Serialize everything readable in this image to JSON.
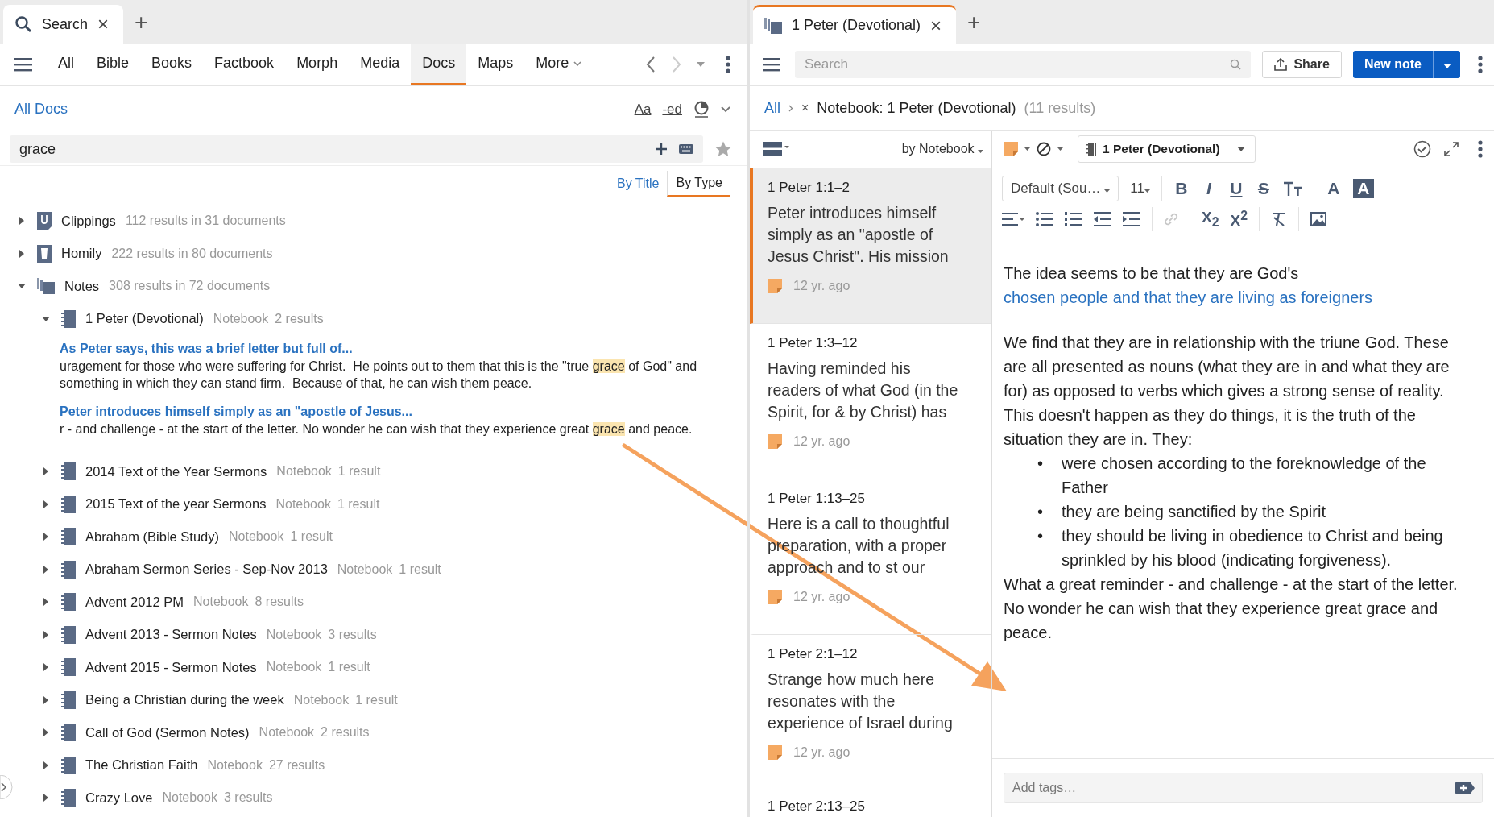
{
  "left_tab": {
    "title": "Search",
    "close": "×",
    "new": "+"
  },
  "left_nav": {
    "items": [
      {
        "label": "All",
        "selected": false
      },
      {
        "label": "Bible",
        "selected": false
      },
      {
        "label": "Books",
        "selected": false
      },
      {
        "label": "Factbook",
        "selected": false
      },
      {
        "label": "Morph",
        "selected": false
      },
      {
        "label": "Media",
        "selected": false
      },
      {
        "label": "Docs",
        "selected": true
      },
      {
        "label": "Maps",
        "selected": false
      }
    ],
    "more": "More"
  },
  "scope": {
    "label": "All Docs",
    "tools": [
      "Aa",
      "-ed"
    ]
  },
  "search": {
    "value": "grace"
  },
  "sort": [
    {
      "label": "By Title",
      "selected": false
    },
    {
      "label": "By Type",
      "selected": true
    }
  ],
  "tree": [
    {
      "kind": "clippings",
      "label": "Clippings",
      "count": "112 results in 31 documents",
      "expanded": false
    },
    {
      "kind": "homily",
      "label": "Homily",
      "count": "222 results in 80 documents",
      "expanded": false
    },
    {
      "kind": "notes",
      "label": "Notes",
      "count": "308 results in 72 documents",
      "expanded": true,
      "children": [
        {
          "label": "1 Peter (Devotional)",
          "type": "Notebook",
          "count": "2 results",
          "expanded": true,
          "results": [
            {
              "title": "As Peter says, this was a brief letter but full of...",
              "before": "uragement for those who were suffering for Christ.  He points out to them that this is the \"true ",
              "match": "grace",
              "after": " of God\" and something in which they can stand firm.  Because of that, he can wish them peace."
            },
            {
              "title": "Peter introduces himself simply as an \"apostle of Jesus...",
              "before": "r - and challenge - at the start of the letter. No wonder he can wish that they experience great ",
              "match": "grace",
              "after": " and peace."
            }
          ]
        },
        {
          "label": "2014 Text of the Year Sermons",
          "type": "Notebook",
          "count": "1 result",
          "expanded": false
        },
        {
          "label": "2015 Text of the year Sermons",
          "type": "Notebook",
          "count": "1 result",
          "expanded": false
        },
        {
          "label": "Abraham (Bible Study)",
          "type": "Notebook",
          "count": "1 result",
          "expanded": false
        },
        {
          "label": "Abraham Sermon Series - Sep-Nov 2013",
          "type": "Notebook",
          "count": "1 result",
          "expanded": false
        },
        {
          "label": "Advent 2012 PM",
          "type": "Notebook",
          "count": "8 results",
          "expanded": false
        },
        {
          "label": "Advent 2013 - Sermon Notes",
          "type": "Notebook",
          "count": "3 results",
          "expanded": false
        },
        {
          "label": "Advent 2015 - Sermon Notes",
          "type": "Notebook",
          "count": "1 result",
          "expanded": false
        },
        {
          "label": "Being a Christian during the week",
          "type": "Notebook",
          "count": "1 result",
          "expanded": false
        },
        {
          "label": "Call of God (Sermon Notes)",
          "type": "Notebook",
          "count": "2 results",
          "expanded": false
        },
        {
          "label": "The Christian Faith",
          "type": "Notebook",
          "count": "27 results",
          "expanded": false
        },
        {
          "label": "Crazy Love",
          "type": "Notebook",
          "count": "3 results",
          "expanded": false
        }
      ]
    }
  ],
  "right_tab": {
    "title": "1 Peter (Devotional)",
    "close": "×",
    "new": "+"
  },
  "notes_toolbar": {
    "placeholder": "Search",
    "share": "Share",
    "new_note": "New note"
  },
  "breadcrumb": {
    "root": "All",
    "remove": "×",
    "filter": "Notebook: 1 Peter (Devotional)",
    "count": "(11 results)"
  },
  "list_header": {
    "group": "by Notebook"
  },
  "notes": [
    {
      "reference": "1 Peter 1:1–2",
      "preview": "Peter introduces himself simply as an \"apostle of Jesus Christ\". His mission",
      "time": "12 yr. ago",
      "selected": true
    },
    {
      "reference": "1 Peter 1:3–12",
      "preview": "Having reminded his readers of what God (in the Spirit, for & by Christ) has",
      "time": "12 yr. ago",
      "selected": false
    },
    {
      "reference": "1 Peter 1:13–25",
      "preview": "Here is a call to thoughtful preparation, with a proper approach and to st our",
      "time": "12 yr. ago",
      "selected": false
    },
    {
      "reference": "1 Peter 2:1–12",
      "preview": "Strange how much here resonates with the experience of Israel during",
      "time": "12 yr. ago",
      "selected": false
    },
    {
      "reference": "1 Peter 2:13–25",
      "selected": false
    }
  ],
  "editor": {
    "notebook": "1 Peter (Devotional)",
    "font": "Default (Sou…",
    "size": "11",
    "format": [
      {
        "kind": "bold",
        "label": "B"
      },
      {
        "kind": "italic",
        "label": "I"
      },
      {
        "kind": "underline",
        "label": "U"
      },
      {
        "kind": "strike",
        "label": "S"
      }
    ],
    "colors": [
      {
        "kind": "text",
        "label": "A"
      },
      {
        "kind": "highlight",
        "label": "A"
      }
    ],
    "scripts": [
      "X$_{2}$",
      "X$^{2}$"
    ],
    "body": [
      {
        "kind": "para",
        "text": "The idea seems to be that they are God's ",
        "link": "chosen people and that they are living as foreigners"
      },
      {
        "kind": "para",
        "text": "We find that they are in relationship with the triune God. These are all presented as nouns (what they are in and what they are for) as opposed to verbs which gives a strong sense of reality. This doesn't happen as they do things, it is the truth of the situation they are in. They:"
      },
      {
        "kind": "bullet",
        "marker": "•",
        "text": "were chosen according to the foreknowledge of the Father"
      },
      {
        "kind": "bullet",
        "marker": "•",
        "text": "they are being sanctified by the Spirit"
      },
      {
        "kind": "bullet",
        "marker": "•",
        "text": "they should be living in obedience to Christ and being sprinkled by his blood (indicating forgiveness)."
      },
      {
        "kind": "para",
        "text": "What a great reminder - and challenge - at the start of the letter. No wonder he can wish that they experience great grace and peace."
      }
    ],
    "tags_placeholder": "Add tags…"
  }
}
